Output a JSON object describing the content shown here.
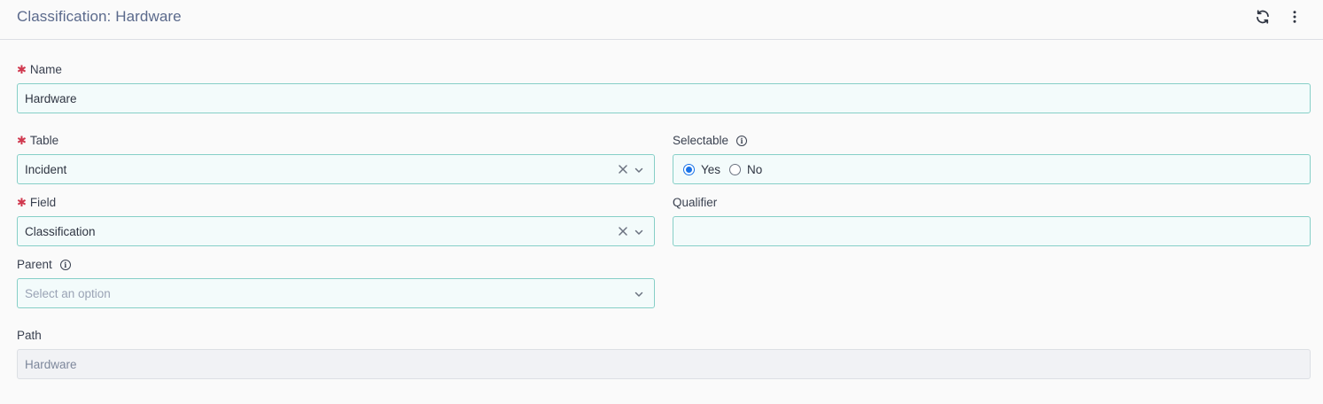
{
  "header": {
    "title": "Classification: Hardware",
    "refresh_icon": "refresh-icon",
    "more_icon": "more-vertical-icon"
  },
  "form": {
    "name": {
      "label": "Name",
      "value": "Hardware",
      "required": true
    },
    "table": {
      "label": "Table",
      "value": "Incident",
      "required": true
    },
    "selectable": {
      "label": "Selectable",
      "options": [
        "Yes",
        "No"
      ],
      "selected": "Yes"
    },
    "field": {
      "label": "Field",
      "value": "Classification",
      "required": true
    },
    "qualifier": {
      "label": "Qualifier",
      "value": ""
    },
    "parent": {
      "label": "Parent",
      "placeholder": "Select an option"
    },
    "path": {
      "label": "Path",
      "value": "Hardware"
    }
  },
  "colors": {
    "accent": "#1a73e8",
    "required": "#d0384e",
    "field_border": "#86cfc7",
    "field_bg": "#f3fbfb"
  }
}
